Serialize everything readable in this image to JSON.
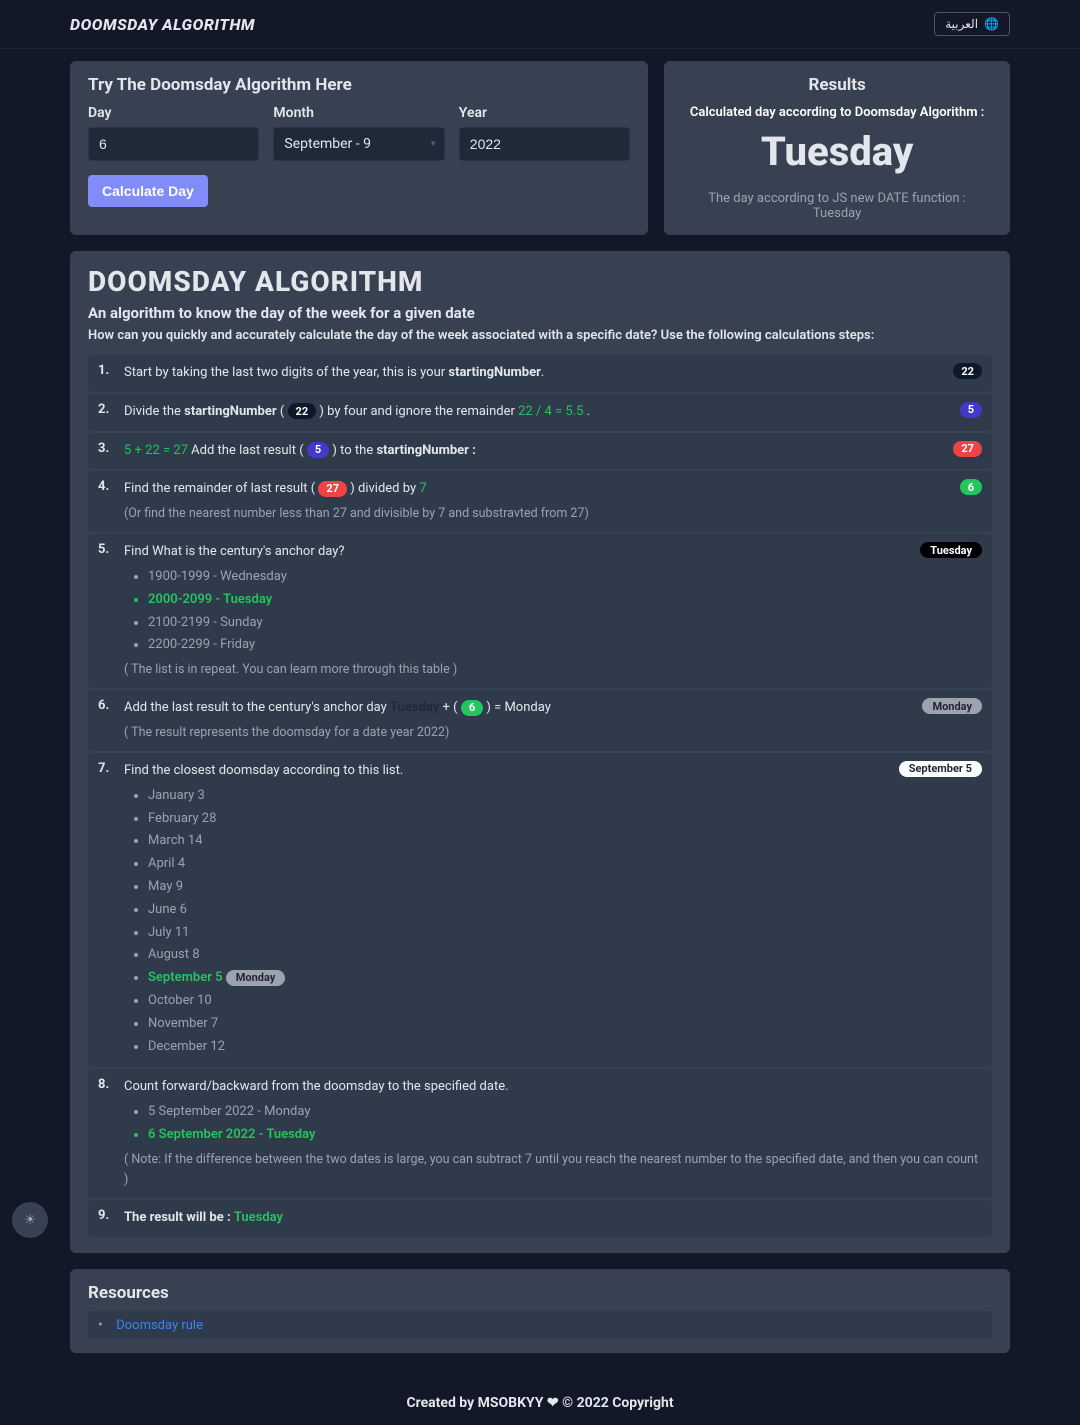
{
  "header": {
    "logo": "DOOMSDAY ALGORITHM",
    "lang_label": "العربية"
  },
  "try": {
    "title": "Try The Doomsday Algorithm Here",
    "labels": {
      "day": "Day",
      "month": "Month",
      "year": "Year"
    },
    "values": {
      "day": "6",
      "month": "September - 9",
      "year": "2022"
    },
    "button": "Calculate Day"
  },
  "results": {
    "title": "Results",
    "sub": "Calculated day according to Doomsday Algorithm :",
    "main": "Tuesday",
    "note_line1": "The day according to JS new DATE function :",
    "note_line2": "Tuesday"
  },
  "algo": {
    "title": "DOOMSDAY ALGORITHM",
    "sub": "An algorithm to know the day of the week for a given date",
    "question": "How can you quickly and accurately calculate the day of the week associated with a specific date? Use the following calculations steps:"
  },
  "steps": {
    "s1": {
      "text_a": "Start by taking the last two digits of the year, this is your ",
      "bold": "startingNumber",
      "suffix": ".",
      "badge": "22"
    },
    "s2": {
      "text_a": "Divide the ",
      "bold1": "startingNumber",
      "mid": " ( ",
      "pill": "22",
      "text_b": " ) by four and ignore the remainder ",
      "calc": "22 / 4 = 5.5",
      "suffix": " .",
      "badge": "5"
    },
    "s3": {
      "calc": "5 + 22 = 27",
      "text": " Add the last result ( ",
      "pill": "5",
      "text_b": " ) to the ",
      "bold": "startingNumber :",
      "badge": "27"
    },
    "s4": {
      "text": "Find the remainder of last result ( ",
      "pill": "27",
      "text_b": " ) divided by ",
      "num": "7",
      "note": "(Or find the nearest number less than 27 and divisible by 7 and substravted from 27)",
      "badge": "6"
    },
    "s5": {
      "text": "Find What is the century's anchor day?",
      "items": [
        "1900-1999 - Wednesday",
        "2000-2099 - Tuesday",
        "2100-2199 - Sunday",
        "2200-2299 - Friday"
      ],
      "active_index": 1,
      "note": "( The list is in repeat. You can learn more through this table )",
      "badge": "Tuesday"
    },
    "s6": {
      "text_a": "Add the last result to the century's anchor day ",
      "anchor": "Tuesday",
      "plus": " + ( ",
      "pill": "6",
      "eq": " ) = Monday",
      "note": "( The result represents the doomsday for a date year 2022)",
      "badge": "Monday"
    },
    "s7": {
      "text": "Find the closest doomsday according to this list.",
      "items": [
        "January 3",
        "February 28",
        "March 14",
        "April 4",
        "May 9",
        "June 6",
        "July 11",
        "August 8",
        "September 5",
        "October 10",
        "November 7",
        "December 12"
      ],
      "active_index": 8,
      "active_pill": "Monday",
      "badge": "September 5"
    },
    "s8": {
      "text": "Count forward/backward from the doomsday to the specified date.",
      "items": [
        "5 September 2022 - Monday",
        "6 September 2022 - Tuesday"
      ],
      "active_index": 1,
      "note": "( Note: If the difference between the two dates is large, you can subtract 7 until you reach the nearest number to the specified date, and then you can count )"
    },
    "s9": {
      "text": "The result will be : ",
      "result": "Tuesday"
    }
  },
  "resources": {
    "title": "Resources",
    "link": "Doomsday rule"
  },
  "footer": {
    "text": "Created by MSOBKYY ❤ © 2022 Copyright"
  }
}
